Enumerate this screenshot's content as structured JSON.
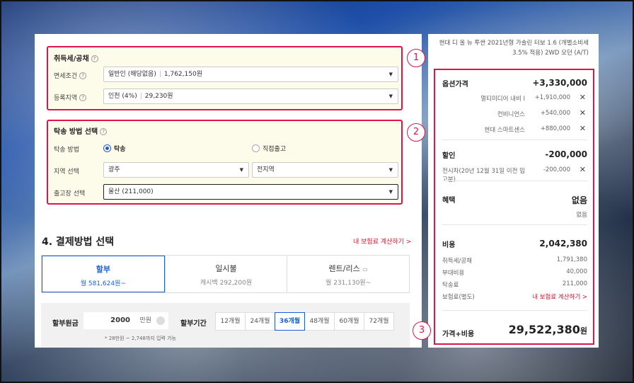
{
  "acquisition": {
    "title": "취득세/공채",
    "exemption_label": "면세조건",
    "exemption_type": "일반인 (해당없음)",
    "exemption_amount": "1,762,150원",
    "region_label": "등록지역",
    "region_value": "인천 (4%)",
    "region_amount": "29,230원",
    "badge": "1"
  },
  "delivery": {
    "title": "탁송 방법 선택",
    "method_label": "탁송 방법",
    "option_delivery": "탁송",
    "option_pickup": "직접출고",
    "area_label": "지역 선택",
    "area_city": "광주",
    "area_district": "전지역",
    "depot_label": "출고장 선택",
    "depot_value": "울산 (211,000)",
    "badge": "2"
  },
  "payment": {
    "title": "4. 결제방법 선택",
    "insurance_link": "내 보험료 계산하기 >",
    "tabs": [
      {
        "label": "할부",
        "sub": "월 581,624원~"
      },
      {
        "label": "일시불",
        "sub": "캐시백 292,200원"
      },
      {
        "label": "렌트/리스",
        "sub": "월 231,130원~"
      }
    ],
    "principal_label": "할부원금",
    "principal_value": "2000",
    "principal_unit": "만원",
    "period_label": "할부기간",
    "months": [
      "12개월",
      "24개월",
      "36개월",
      "48개월",
      "60개월",
      "72개월"
    ],
    "selected_month": "36개월",
    "note": "* 28만원 ~ 2,748까지 입력 가능"
  },
  "summary": {
    "car_line1": "현대 디 올 뉴 투싼 2021년형 가솔린 터보 1.6 (개별소비세",
    "car_line2": "3.5% 적용) 2WD 모던 (A/T)",
    "options_label": "옵션가격",
    "options_total": "+3,330,000",
    "options": [
      {
        "name": "멀티미디어 내비 I",
        "price": "+1,910,000"
      },
      {
        "name": "컨비니언스",
        "price": "+540,000"
      },
      {
        "name": "현대 스마트센스",
        "price": "+880,000"
      }
    ],
    "discount_label": "할인",
    "discount_total": "-200,000",
    "discount_item": "전시차(20년 12월 31일 이전 입고분)",
    "discount_item_price": "-200,000",
    "benefit_label": "혜택",
    "benefit_value": "없음",
    "benefit_sub": "없음",
    "cost_label": "비용",
    "cost_total": "2,042,380",
    "costs": [
      {
        "name": "취득세/공채",
        "price": "1,791,380"
      },
      {
        "name": "부대비용",
        "price": "40,000"
      },
      {
        "name": "탁송료",
        "price": "211,000"
      }
    ],
    "insurance_label": "보험료(별도)",
    "insurance_link": "내 보험료 계산하기 >",
    "total_label": "가격+비용",
    "total_value": "29,522,380",
    "total_unit": "원",
    "badge": "3"
  },
  "colors": {
    "accent": "#1a5fd6",
    "highlight": "#e0144c",
    "box_bg": "#fdfbe9"
  }
}
